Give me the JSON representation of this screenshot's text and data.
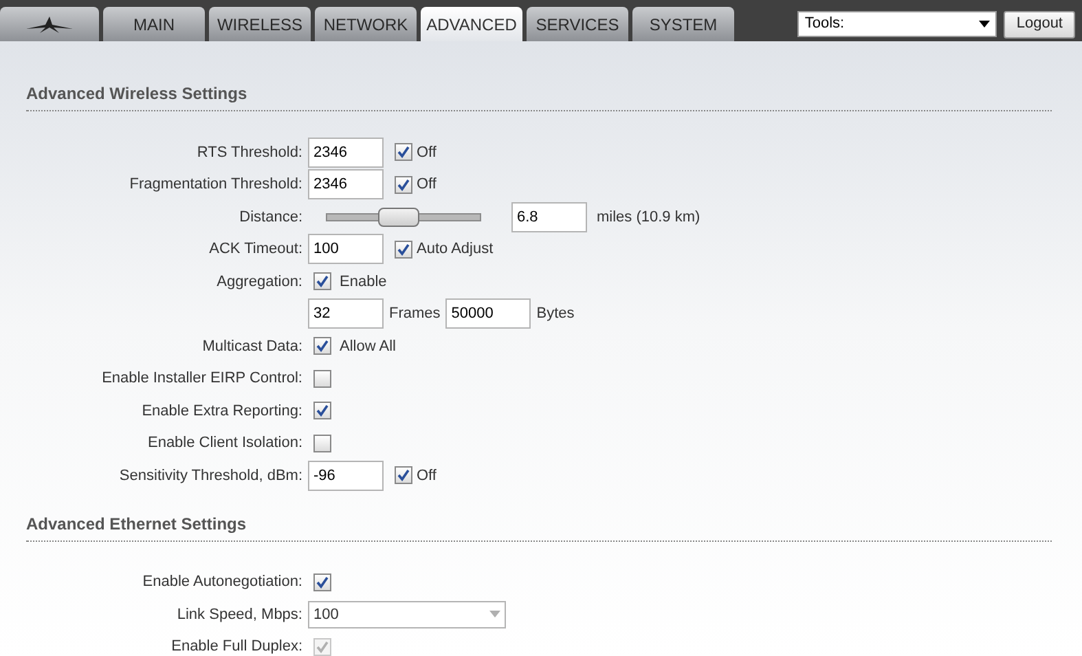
{
  "tabs": [
    {
      "kind": "logo",
      "selected": false
    },
    {
      "kind": "text",
      "label": "MAIN",
      "selected": false
    },
    {
      "kind": "text",
      "label": "WIRELESS",
      "selected": false
    },
    {
      "kind": "text",
      "label": "NETWORK",
      "selected": false
    },
    {
      "kind": "text",
      "label": "ADVANCED",
      "selected": true
    },
    {
      "kind": "text",
      "label": "SERVICES",
      "selected": false
    },
    {
      "kind": "text",
      "label": "SYSTEM",
      "selected": false
    }
  ],
  "tools": {
    "value": "Tools:"
  },
  "logout": "Logout",
  "sections": [
    {
      "title": "Advanced Wireless Settings",
      "rows": [
        {
          "kind": "field_check",
          "label": "RTS Threshold:",
          "value": "2346",
          "checked": true,
          "text": "Off"
        },
        {
          "kind": "field_check",
          "label": "Fragmentation Threshold:",
          "value": "2346",
          "checked": true,
          "text": "Off"
        },
        {
          "kind": "slider",
          "label": "Distance:",
          "level": 0.46,
          "value": "6.8",
          "text": "miles (10.9 km)"
        },
        {
          "kind": "field_check",
          "label": "ACK Timeout:",
          "value": "100",
          "checked": true,
          "text": "Auto Adjust"
        },
        {
          "kind": "check",
          "label": "Aggregation:",
          "checked": true,
          "text": "Enable",
          "disabled": false
        },
        {
          "kind": "pair",
          "value": "32",
          "unit": "Frames",
          "value2": "50000",
          "unit2": "Bytes"
        },
        {
          "kind": "check",
          "label": "Multicast Data:",
          "checked": true,
          "text": "Allow All",
          "disabled": false
        },
        {
          "kind": "check",
          "label": "Enable Installer EIRP Control:",
          "checked": false,
          "disabled": false
        },
        {
          "kind": "check",
          "label": "Enable Extra Reporting:",
          "checked": true,
          "disabled": false
        },
        {
          "kind": "check",
          "label": "Enable Client Isolation:",
          "checked": false,
          "disabled": false
        },
        {
          "kind": "field_check",
          "label": "Sensitivity Threshold, dBm:",
          "value": "-96",
          "checked": true,
          "text": "Off"
        }
      ]
    },
    {
      "title": "Advanced Ethernet Settings",
      "rows": [
        {
          "kind": "check",
          "label": "Enable Autonegotiation:",
          "checked": true,
          "disabled": false
        },
        {
          "kind": "select",
          "label": "Link Speed, Mbps:",
          "value": "100"
        },
        {
          "kind": "check",
          "label": "Enable Full Duplex:",
          "checked": true,
          "disabled": true
        }
      ]
    }
  ]
}
